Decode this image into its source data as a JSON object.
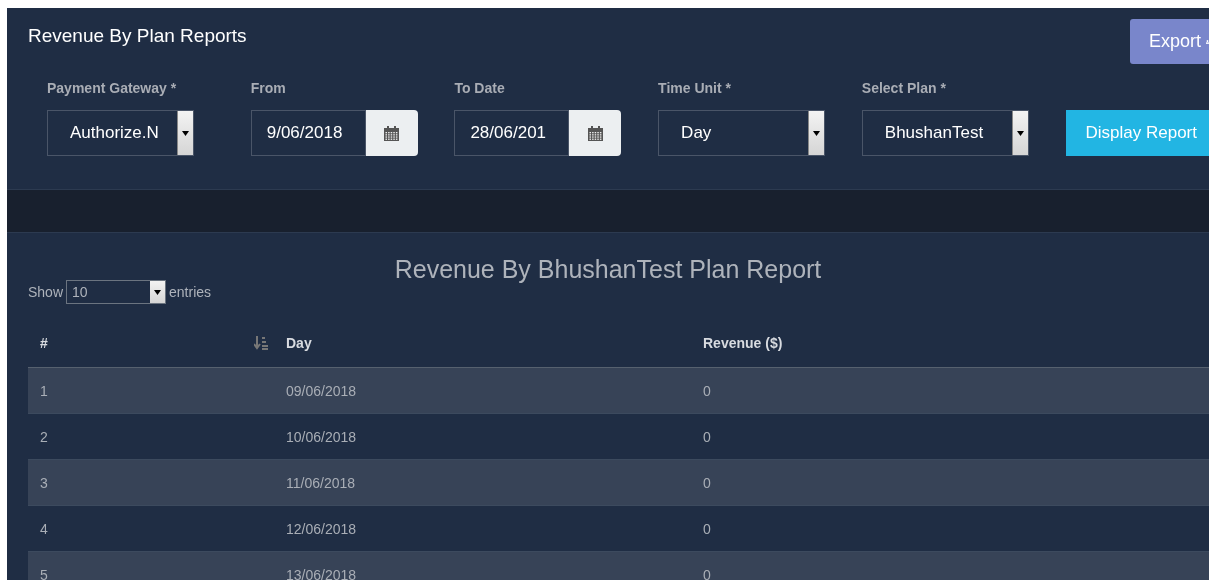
{
  "header": {
    "title": "Revenue By Plan Reports",
    "export_button": "Export"
  },
  "filters": [
    {
      "kind": "select",
      "label": "Payment Gateway *",
      "value": "Authorize.N"
    },
    {
      "kind": "date",
      "label": "From",
      "value": "9/06/2018"
    },
    {
      "kind": "date",
      "label": "To Date",
      "value": "28/06/201"
    },
    {
      "kind": "select",
      "label": "Time Unit *",
      "value": "Day"
    },
    {
      "kind": "select",
      "label": "Select Plan *",
      "value": "BhushanTest"
    }
  ],
  "display_button": "Display Report",
  "report": {
    "title": "Revenue By BhushanTest Plan Report",
    "show_label": "Show",
    "page_size": "10",
    "entries_label": "entries",
    "columns": [
      "#",
      "Day",
      "Revenue ($)"
    ],
    "rows": [
      [
        "1",
        "09/06/2018",
        "0"
      ],
      [
        "2",
        "10/06/2018",
        "0"
      ],
      [
        "3",
        "11/06/2018",
        "0"
      ],
      [
        "4",
        "12/06/2018",
        "0"
      ],
      [
        "5",
        "13/06/2018",
        "0"
      ]
    ]
  }
}
